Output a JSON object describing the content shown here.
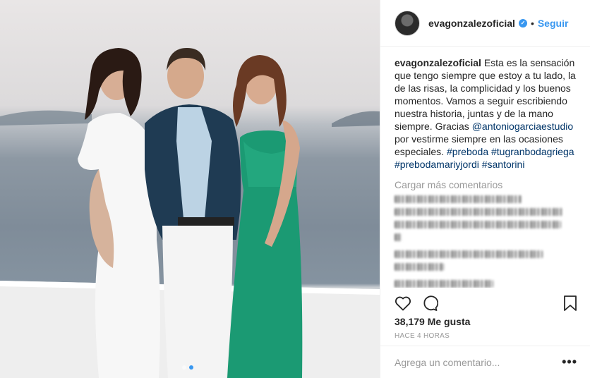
{
  "post": {
    "username": "evagonzalezoficial",
    "follow_label": "Seguir",
    "bullet": "•",
    "caption_parts": {
      "user": "evagonzalezoficial",
      "text1": " Esta es la sensación que tengo siempre que estoy a tu lado, la de las risas, la complicidad y los buenos momentos. Vamos a seguir escribiendo nuestra historia, juntas y de la mano siempre. Gracias ",
      "mention": "@antoniogarciaestudio",
      "text2": " por vestirme siempre en las ocasiones especiales. ",
      "hashtags": "#preboda #tugranbodagriega #prebodamariyjordi #santorini"
    },
    "load_more": "Cargar más comentarios",
    "likes": "38,179 Me gusta",
    "time": "HACE 4 HORAS",
    "comment_placeholder": "Agrega un comentario...",
    "more": "•••"
  },
  "icons": {
    "like": "heart-icon",
    "comment": "comment-icon",
    "save": "bookmark-icon",
    "verified": "verified-badge-icon"
  },
  "colors": {
    "accent": "#3897f0",
    "muted": "#999999",
    "text": "#262626"
  }
}
